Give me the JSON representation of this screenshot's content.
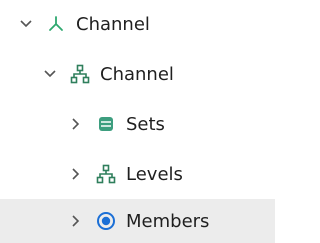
{
  "colors": {
    "selected_row_bg": "#ececec",
    "chevron": "#555555",
    "dimension_icon": "#2ea86f",
    "hierarchy_icon": "#2f7f5c",
    "sets_icon": "#3d9e7f",
    "members_icon": "#1b6fd6"
  },
  "tree": {
    "items": [
      {
        "label": "Channel",
        "icon": "dimension-icon",
        "expanded": true
      },
      {
        "label": "Channel",
        "icon": "hierarchy-icon",
        "expanded": true
      },
      {
        "label": "Sets",
        "icon": "sets-icon",
        "expanded": false
      },
      {
        "label": "Levels",
        "icon": "hierarchy-icon",
        "expanded": false
      },
      {
        "label": "Members",
        "icon": "members-icon",
        "expanded": false,
        "selected": true
      }
    ]
  }
}
